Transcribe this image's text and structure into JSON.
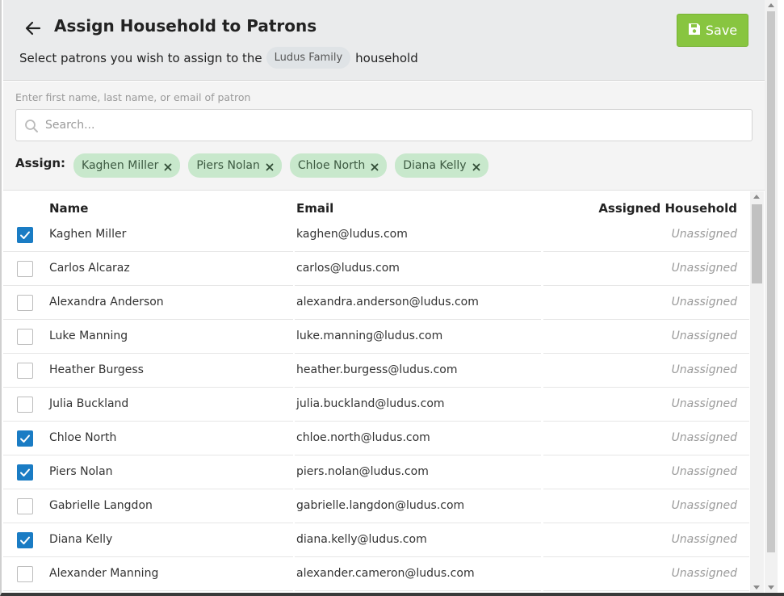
{
  "header": {
    "title": "Assign Household to Patrons",
    "subtitle_prefix": "Select patrons you wish to assign to the",
    "household_name": "Ludus Family",
    "subtitle_suffix": "household",
    "save_label": "Save",
    "save_color": "#88c540"
  },
  "search": {
    "hint": "Enter first name, last name, or email of patron",
    "placeholder": "Search...",
    "value": ""
  },
  "assign": {
    "label": "Assign:",
    "chips": [
      "Kaghen Miller",
      "Piers Nolan",
      "Chloe North",
      "Diana Kelly"
    ],
    "chip_color": "#c8e8cc"
  },
  "table": {
    "headers": {
      "name": "Name",
      "email": "Email",
      "household": "Assigned Household"
    },
    "checkbox_color": "#1a7cc4",
    "rows": [
      {
        "checked": true,
        "name": "Kaghen Miller",
        "email": "kaghen@ludus.com",
        "household": "Unassigned"
      },
      {
        "checked": false,
        "name": "Carlos Alcaraz",
        "email": "carlos@ludus.com",
        "household": "Unassigned"
      },
      {
        "checked": false,
        "name": "Alexandra Anderson",
        "email": "alexandra.anderson@ludus.com",
        "household": "Unassigned"
      },
      {
        "checked": false,
        "name": "Luke Manning",
        "email": "luke.manning@ludus.com",
        "household": "Unassigned"
      },
      {
        "checked": false,
        "name": "Heather Burgess",
        "email": "heather.burgess@ludus.com",
        "household": "Unassigned"
      },
      {
        "checked": false,
        "name": "Julia Buckland",
        "email": "julia.buckland@ludus.com",
        "household": "Unassigned"
      },
      {
        "checked": true,
        "name": "Chloe North",
        "email": "chloe.north@ludus.com",
        "household": "Unassigned"
      },
      {
        "checked": true,
        "name": "Piers Nolan",
        "email": "piers.nolan@ludus.com",
        "household": "Unassigned"
      },
      {
        "checked": false,
        "name": "Gabrielle Langdon",
        "email": "gabrielle.langdon@ludus.com",
        "household": "Unassigned"
      },
      {
        "checked": true,
        "name": "Diana Kelly",
        "email": "diana.kelly@ludus.com",
        "household": "Unassigned"
      },
      {
        "checked": false,
        "name": "Alexander Manning",
        "email": "alexander.cameron@ludus.com",
        "household": "Unassigned"
      }
    ]
  }
}
